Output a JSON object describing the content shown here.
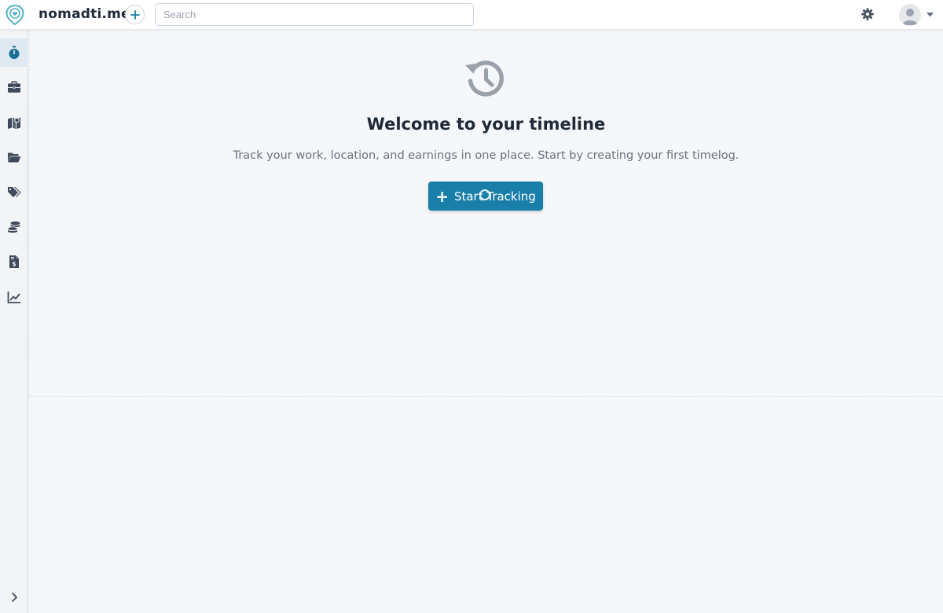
{
  "header": {
    "brand": "nomadti.me",
    "add_label": "+",
    "search_placeholder": "Search",
    "search_value": "",
    "settings_icon": "gear-icon",
    "avatar_icon": "user-avatar-icon",
    "menu_caret_icon": "caret-down-icon"
  },
  "sidebar": {
    "items": [
      {
        "name": "stopwatch",
        "icon": "stopwatch-icon",
        "active": true
      },
      {
        "name": "briefcase",
        "icon": "briefcase-icon",
        "active": false
      },
      {
        "name": "map",
        "icon": "map-icon",
        "active": false
      },
      {
        "name": "folder",
        "icon": "folder-open-icon",
        "active": false
      },
      {
        "name": "tags",
        "icon": "tags-icon",
        "active": false
      },
      {
        "name": "coins",
        "icon": "coins-icon",
        "active": false
      },
      {
        "name": "invoice",
        "icon": "invoice-dollar-icon",
        "active": false
      },
      {
        "name": "chart",
        "icon": "chart-line-icon",
        "active": false
      }
    ],
    "expand_icon": "chevron-right-icon"
  },
  "main": {
    "empty_icon": "history-icon",
    "title": "Welcome to your timeline",
    "subtitle": "Track your work, location, and earnings in one place. Start by creating your first timelog.",
    "start_button": {
      "plus": "+",
      "label": "Start Tracking"
    }
  },
  "colors": {
    "accent": "#1a7fa8",
    "logo": "#4fb3c9",
    "background": "#f5f7fa",
    "sidebar_active": "#dfe9f1",
    "icon": "#3f4a5a"
  }
}
